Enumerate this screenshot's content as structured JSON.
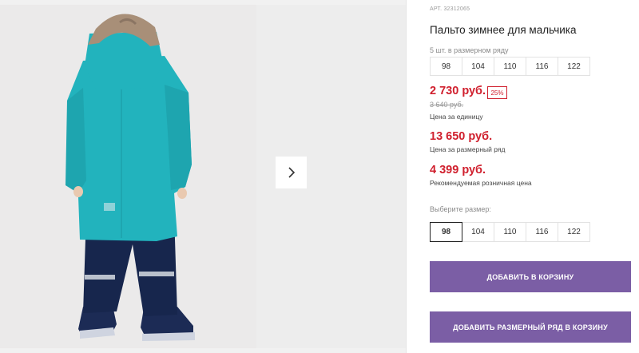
{
  "product": {
    "article_label": "АРТ.",
    "article_number": "32312065",
    "title": "Пальто зимнее для мальчика",
    "pack_note": "5 шт. в размерном ряду",
    "pack_sizes": [
      "98",
      "104",
      "110",
      "116",
      "122"
    ]
  },
  "pricing": {
    "unit_price": "2 730 руб.",
    "discount": "25%",
    "old_price": "3 640 руб.",
    "unit_caption": "Цена за единицу",
    "pack_price": "13 650 руб.",
    "pack_caption": "Цена за размерный ряд",
    "retail_price": "4 399 руб.",
    "retail_caption": "Рекомендуемая розничная цена"
  },
  "size_picker": {
    "label": "Выберите размер:",
    "sizes": [
      "98",
      "104",
      "110",
      "116",
      "122"
    ],
    "selected": "98"
  },
  "buttons": {
    "add_to_cart": "ДОБАВИТЬ В КОРЗИНУ",
    "add_pack_to_cart": "ДОБАВИТЬ РАЗМЕРНЫЙ РЯД В КОРЗИНУ"
  },
  "colors": {
    "accent_purple": "#7b5ea5",
    "price_red": "#d0202e",
    "coat_teal": "#22b3bd",
    "pants_navy": "#17264d"
  },
  "icons": {
    "next": "chevron-right-icon"
  }
}
